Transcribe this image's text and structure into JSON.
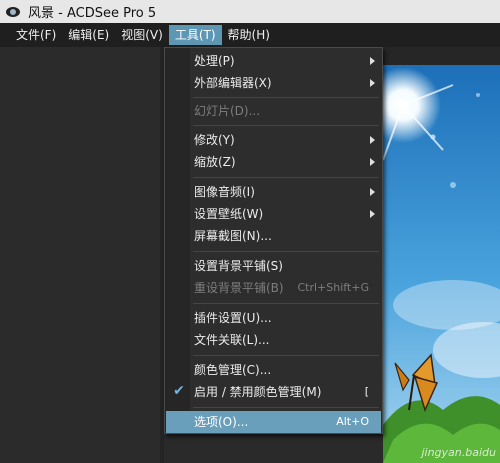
{
  "window": {
    "title": "风景 - ACDSee Pro 5"
  },
  "menubar": [
    {
      "label": "文件(F)"
    },
    {
      "label": "编辑(E)"
    },
    {
      "label": "视图(V)"
    },
    {
      "label": "工具(T)",
      "active": true
    },
    {
      "label": "帮助(H)"
    }
  ],
  "tools_menu": {
    "items": [
      {
        "label": "处理(P)",
        "submenu": true
      },
      {
        "label": "外部编辑器(X)",
        "submenu": true
      },
      {
        "label": "幻灯片(D)...",
        "disabled": true
      },
      {
        "label": "修改(Y)",
        "submenu": true
      },
      {
        "label": "缩放(Z)",
        "submenu": true
      },
      {
        "label": "图像音频(I)",
        "submenu": true
      },
      {
        "label": "设置壁纸(W)",
        "submenu": true
      },
      {
        "label": "屏幕截图(N)..."
      },
      {
        "label": "设置背景平铺(S)"
      },
      {
        "label": "重设背景平铺(B)",
        "shortcut": "Ctrl+Shift+G",
        "disabled": true
      },
      {
        "label": "插件设置(U)..."
      },
      {
        "label": "文件关联(L)..."
      },
      {
        "label": "颜色管理(C)..."
      },
      {
        "label": "启用 / 禁用颜色管理(M)",
        "shortcut": "[",
        "checked": true
      },
      {
        "label": "选项(O)...",
        "shortcut": "Alt+O",
        "selected": true
      }
    ]
  },
  "watermark": "jingyan.baidu",
  "colors": {
    "menu_highlight": "#6a9fbc",
    "menubar_active": "#5e97b4",
    "sky": "#2f86c9"
  }
}
